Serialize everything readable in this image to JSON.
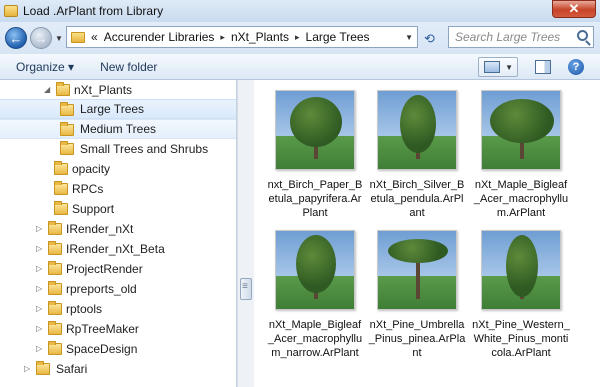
{
  "window": {
    "title": "Load .ArPlant from Library",
    "close_glyph": "✕"
  },
  "nav": {
    "back_glyph": "←",
    "forward_glyph": "→"
  },
  "address": {
    "crumbs": [
      "Accurender Libraries",
      "nXt_Plants",
      "Large Trees"
    ],
    "prefix": "«",
    "separator": "▸"
  },
  "search": {
    "placeholder": "Search Large Trees"
  },
  "toolbar": {
    "organize_label": "Organize ▾",
    "new_folder_label": "New folder",
    "help_label": "?"
  },
  "tree": [
    {
      "label": "nXt_Plants",
      "state": "expanded"
    },
    {
      "label": "Large Trees",
      "state": "selected"
    },
    {
      "label": "Medium Trees",
      "state": "hover"
    },
    {
      "label": "Small Trees and Shrubs",
      "state": "normal"
    },
    {
      "label": "opacity",
      "state": "normal"
    },
    {
      "label": "RPCs",
      "state": "normal"
    },
    {
      "label": "Support",
      "state": "normal"
    },
    {
      "label": "IRender_nXt",
      "state": "collapsed"
    },
    {
      "label": "IRender_nXt_Beta",
      "state": "collapsed"
    },
    {
      "label": "ProjectRender",
      "state": "collapsed"
    },
    {
      "label": "rpreports_old",
      "state": "collapsed"
    },
    {
      "label": "rptools",
      "state": "collapsed"
    },
    {
      "label": "RpTreeMaker",
      "state": "collapsed"
    },
    {
      "label": "SpaceDesign",
      "state": "collapsed"
    },
    {
      "label": "Safari",
      "state": "collapsed"
    }
  ],
  "files": [
    {
      "name": "nxt_Birch_Paper_Betula_papyrifera.ArPlant"
    },
    {
      "name": "nXt_Birch_Silver_Betula_pendula.ArPlant"
    },
    {
      "name": "nXt_Maple_Bigleaf_Acer_macrophyllum.ArPlant"
    },
    {
      "name": "nXt_Maple_Bigleaf_Acer_macrophyllum_narrow.ArPlant"
    },
    {
      "name": "nXt_Pine_Umbrella_Pinus_pinea.ArPlant"
    },
    {
      "name": "nXt_Pine_Western_White_Pinus_monticola.ArPlant"
    }
  ]
}
